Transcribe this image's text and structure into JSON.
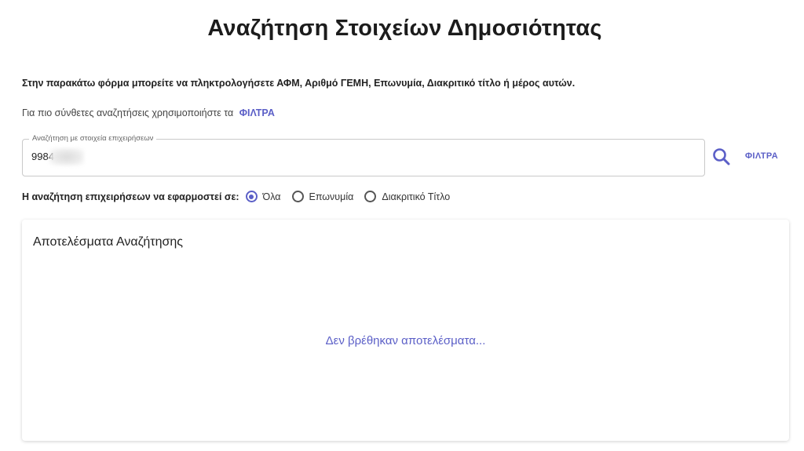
{
  "page": {
    "title": "Αναζήτηση Στοιχείων Δημοσιότητας",
    "instructions": "Στην παρακάτω φόρμα μπορείτε να πληκτρολογήσετε ΑΦΜ, Αριθμό ΓΕΜΗ, Επωνυμία, Διακριτικό τίτλο ή μέρος αυτών.",
    "hint_text": "Για πιο σύνθετες αναζητήσεις χρησιμοποιήστε τα",
    "hint_link": "ΦΙΛΤΡΑ"
  },
  "search": {
    "label": "Αναζήτηση με στοιχεία επιχειρήσεων",
    "value": "9984",
    "filters_label": "ΦΙΛΤΡΑ",
    "search_icon": "magnifier-icon",
    "accent_color": "#5b5fc7"
  },
  "scope": {
    "label": "Η αναζήτηση επιχειρήσεων να εφαρμοστεί σε:",
    "options": [
      "Όλα",
      "Επωνυμία",
      "Διακριτικό Τίτλο"
    ],
    "selected": "Όλα"
  },
  "results": {
    "title": "Αποτελέσματα Αναζήτησης",
    "empty_message": "Δεν βρέθηκαν αποτελέσματα..."
  }
}
